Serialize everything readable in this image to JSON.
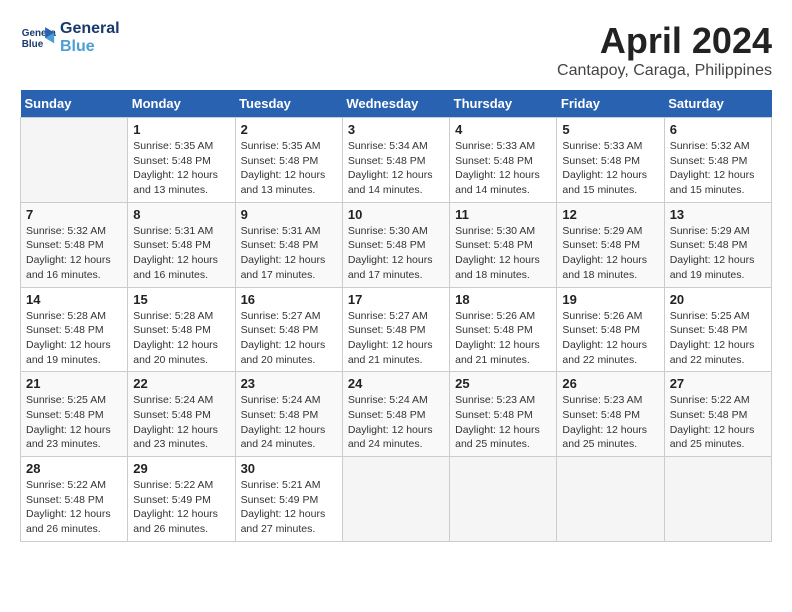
{
  "header": {
    "logo_line1": "General",
    "logo_line2": "Blue",
    "title": "April 2024",
    "subtitle": "Cantapoy, Caraga, Philippines"
  },
  "days_of_week": [
    "Sunday",
    "Monday",
    "Tuesday",
    "Wednesday",
    "Thursday",
    "Friday",
    "Saturday"
  ],
  "weeks": [
    [
      {
        "num": "",
        "info": ""
      },
      {
        "num": "1",
        "info": "Sunrise: 5:35 AM\nSunset: 5:48 PM\nDaylight: 12 hours\nand 13 minutes."
      },
      {
        "num": "2",
        "info": "Sunrise: 5:35 AM\nSunset: 5:48 PM\nDaylight: 12 hours\nand 13 minutes."
      },
      {
        "num": "3",
        "info": "Sunrise: 5:34 AM\nSunset: 5:48 PM\nDaylight: 12 hours\nand 14 minutes."
      },
      {
        "num": "4",
        "info": "Sunrise: 5:33 AM\nSunset: 5:48 PM\nDaylight: 12 hours\nand 14 minutes."
      },
      {
        "num": "5",
        "info": "Sunrise: 5:33 AM\nSunset: 5:48 PM\nDaylight: 12 hours\nand 15 minutes."
      },
      {
        "num": "6",
        "info": "Sunrise: 5:32 AM\nSunset: 5:48 PM\nDaylight: 12 hours\nand 15 minutes."
      }
    ],
    [
      {
        "num": "7",
        "info": "Sunrise: 5:32 AM\nSunset: 5:48 PM\nDaylight: 12 hours\nand 16 minutes."
      },
      {
        "num": "8",
        "info": "Sunrise: 5:31 AM\nSunset: 5:48 PM\nDaylight: 12 hours\nand 16 minutes."
      },
      {
        "num": "9",
        "info": "Sunrise: 5:31 AM\nSunset: 5:48 PM\nDaylight: 12 hours\nand 17 minutes."
      },
      {
        "num": "10",
        "info": "Sunrise: 5:30 AM\nSunset: 5:48 PM\nDaylight: 12 hours\nand 17 minutes."
      },
      {
        "num": "11",
        "info": "Sunrise: 5:30 AM\nSunset: 5:48 PM\nDaylight: 12 hours\nand 18 minutes."
      },
      {
        "num": "12",
        "info": "Sunrise: 5:29 AM\nSunset: 5:48 PM\nDaylight: 12 hours\nand 18 minutes."
      },
      {
        "num": "13",
        "info": "Sunrise: 5:29 AM\nSunset: 5:48 PM\nDaylight: 12 hours\nand 19 minutes."
      }
    ],
    [
      {
        "num": "14",
        "info": "Sunrise: 5:28 AM\nSunset: 5:48 PM\nDaylight: 12 hours\nand 19 minutes."
      },
      {
        "num": "15",
        "info": "Sunrise: 5:28 AM\nSunset: 5:48 PM\nDaylight: 12 hours\nand 20 minutes."
      },
      {
        "num": "16",
        "info": "Sunrise: 5:27 AM\nSunset: 5:48 PM\nDaylight: 12 hours\nand 20 minutes."
      },
      {
        "num": "17",
        "info": "Sunrise: 5:27 AM\nSunset: 5:48 PM\nDaylight: 12 hours\nand 21 minutes."
      },
      {
        "num": "18",
        "info": "Sunrise: 5:26 AM\nSunset: 5:48 PM\nDaylight: 12 hours\nand 21 minutes."
      },
      {
        "num": "19",
        "info": "Sunrise: 5:26 AM\nSunset: 5:48 PM\nDaylight: 12 hours\nand 22 minutes."
      },
      {
        "num": "20",
        "info": "Sunrise: 5:25 AM\nSunset: 5:48 PM\nDaylight: 12 hours\nand 22 minutes."
      }
    ],
    [
      {
        "num": "21",
        "info": "Sunrise: 5:25 AM\nSunset: 5:48 PM\nDaylight: 12 hours\nand 23 minutes."
      },
      {
        "num": "22",
        "info": "Sunrise: 5:24 AM\nSunset: 5:48 PM\nDaylight: 12 hours\nand 23 minutes."
      },
      {
        "num": "23",
        "info": "Sunrise: 5:24 AM\nSunset: 5:48 PM\nDaylight: 12 hours\nand 24 minutes."
      },
      {
        "num": "24",
        "info": "Sunrise: 5:24 AM\nSunset: 5:48 PM\nDaylight: 12 hours\nand 24 minutes."
      },
      {
        "num": "25",
        "info": "Sunrise: 5:23 AM\nSunset: 5:48 PM\nDaylight: 12 hours\nand 25 minutes."
      },
      {
        "num": "26",
        "info": "Sunrise: 5:23 AM\nSunset: 5:48 PM\nDaylight: 12 hours\nand 25 minutes."
      },
      {
        "num": "27",
        "info": "Sunrise: 5:22 AM\nSunset: 5:48 PM\nDaylight: 12 hours\nand 25 minutes."
      }
    ],
    [
      {
        "num": "28",
        "info": "Sunrise: 5:22 AM\nSunset: 5:48 PM\nDaylight: 12 hours\nand 26 minutes."
      },
      {
        "num": "29",
        "info": "Sunrise: 5:22 AM\nSunset: 5:49 PM\nDaylight: 12 hours\nand 26 minutes."
      },
      {
        "num": "30",
        "info": "Sunrise: 5:21 AM\nSunset: 5:49 PM\nDaylight: 12 hours\nand 27 minutes."
      },
      {
        "num": "",
        "info": ""
      },
      {
        "num": "",
        "info": ""
      },
      {
        "num": "",
        "info": ""
      },
      {
        "num": "",
        "info": ""
      }
    ]
  ]
}
